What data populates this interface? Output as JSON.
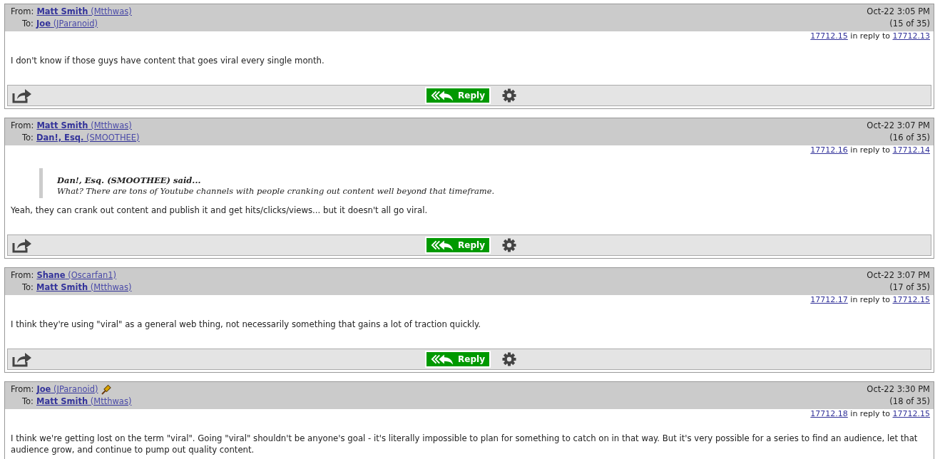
{
  "posts": [
    {
      "from": {
        "label": "From:",
        "name": "Matt Smith",
        "handle": "(Mtthwas)"
      },
      "to": {
        "label": "To:",
        "name": "Joe",
        "handle": "(JParanoid)"
      },
      "date": "Oct-22 3:05 PM",
      "count": "(15 of 35)",
      "msg_id": "17712.15",
      "reply_text": "in reply to",
      "reply_to": "17712.13",
      "body": "I don't know if those guys have content that goes viral every single month.",
      "reply_label": "Reply"
    },
    {
      "from": {
        "label": "From:",
        "name": "Matt Smith",
        "handle": "(Mtthwas)"
      },
      "to": {
        "label": "To:",
        "name": "Dan!, Esq.",
        "handle": "(SMOOTHEE)"
      },
      "date": "Oct-22 3:07 PM",
      "count": "(16 of 35)",
      "msg_id": "17712.16",
      "reply_text": "in reply to",
      "reply_to": "17712.14",
      "quote": {
        "author": "Dan!, Esq. (SMOOTHEE) said...",
        "text": "What? There are tons of Youtube channels with people cranking out content well beyond that timeframe."
      },
      "body": "Yeah, they can crank out content and publish it and get hits/clicks/views... but it doesn't all go viral.",
      "reply_label": "Reply"
    },
    {
      "from": {
        "label": "From:",
        "name": "Shane",
        "handle": "(Oscarfan1)"
      },
      "to": {
        "label": "To:",
        "name": "Matt Smith",
        "handle": "(Mtthwas)"
      },
      "date": "Oct-22 3:07 PM",
      "count": "(17 of 35)",
      "msg_id": "17712.17",
      "reply_text": "in reply to",
      "reply_to": "17712.15",
      "body": "I think they're using \"viral\" as a general web thing, not necessarily something that gains a lot of traction quickly.",
      "reply_label": "Reply"
    },
    {
      "from": {
        "label": "From:",
        "name": "Joe",
        "handle": "(JParanoid)",
        "moderator": true
      },
      "to": {
        "label": "To:",
        "name": "Matt Smith",
        "handle": "(Mtthwas)"
      },
      "date": "Oct-22 3:30 PM",
      "count": "(18 of 35)",
      "msg_id": "17712.18",
      "reply_text": "in reply to",
      "reply_to": "17712.15",
      "body": "I think we're getting lost on the term \"viral\".  Going \"viral\" shouldn't be anyone's goal - it's literally impossible to plan for something to catch on in that way.  But it's very possible for a series to find an audience, let that audience grow, and continue to pump out quality content."
    }
  ]
}
